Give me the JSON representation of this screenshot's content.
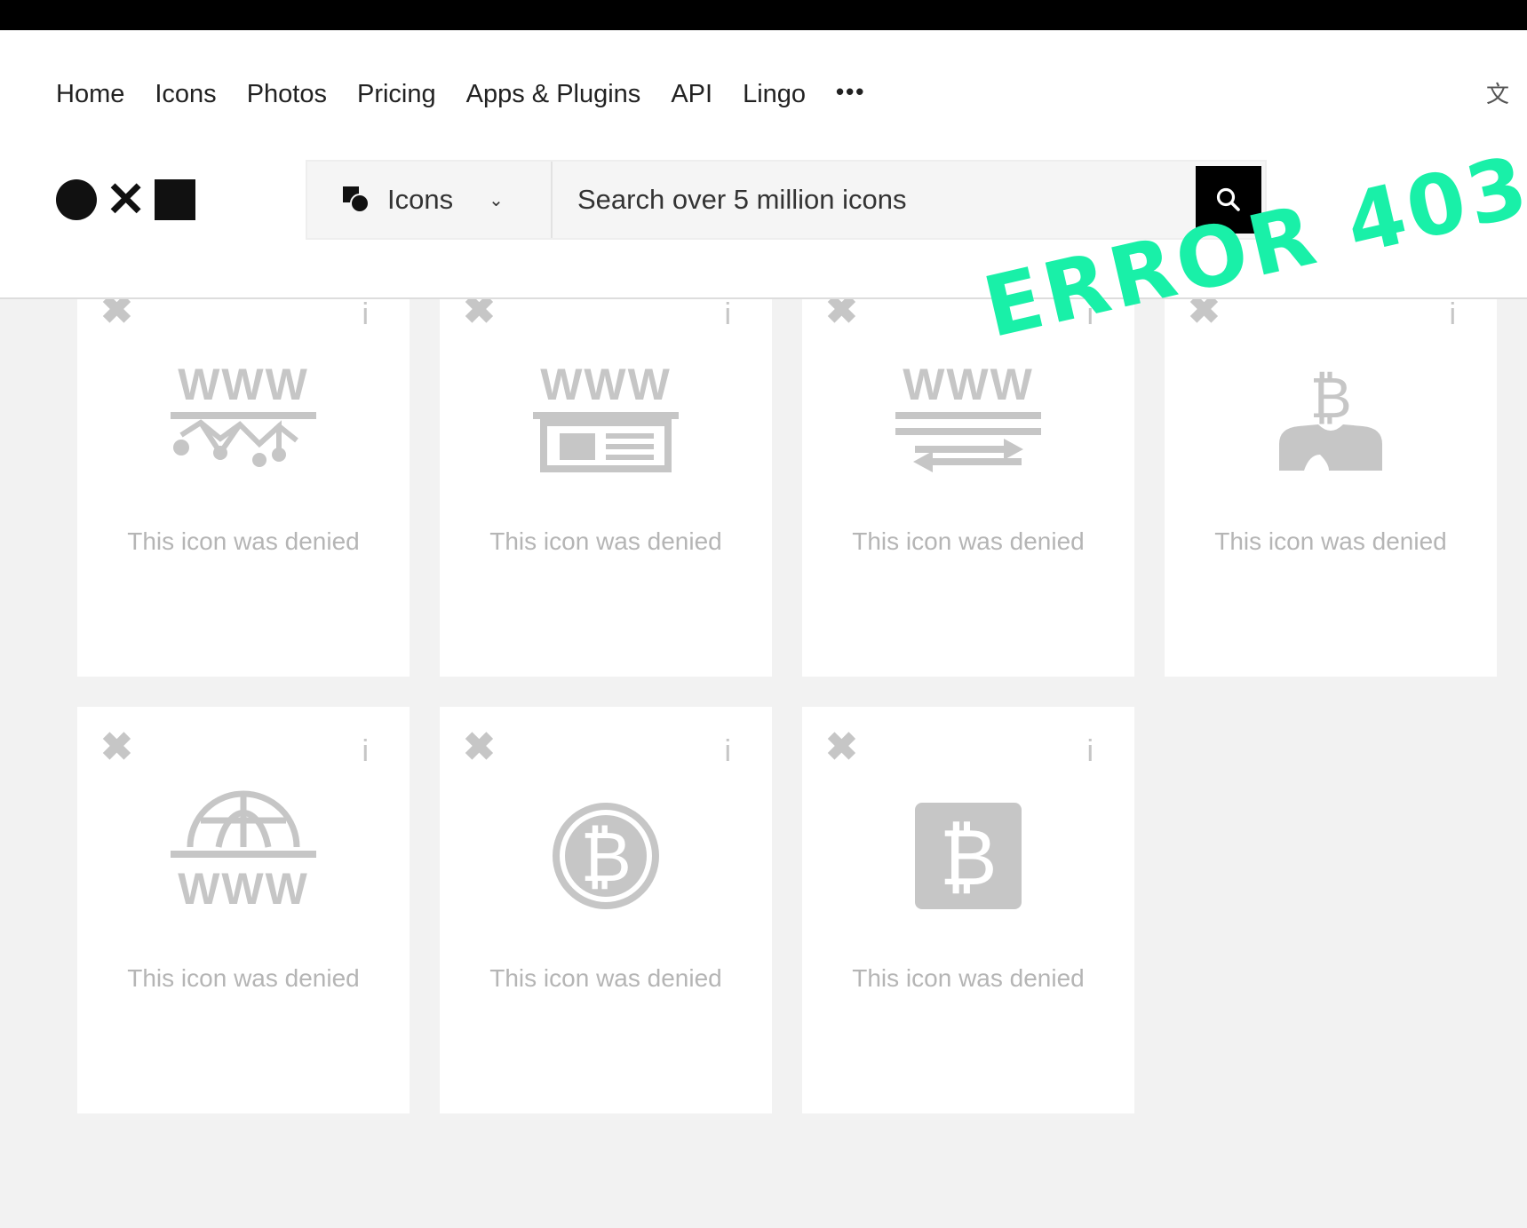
{
  "nav": {
    "items": [
      "Home",
      "Icons",
      "Photos",
      "Pricing",
      "Apps & Plugins",
      "API",
      "Lingo"
    ],
    "more": "•••",
    "corner_icon": "translate-icon"
  },
  "search": {
    "type_label": "Icons",
    "placeholder": "Search over 5 million icons",
    "search_icon": "search-icon"
  },
  "cards": [
    {
      "status": "This icon was denied",
      "icon": "www-network-icon"
    },
    {
      "status": "This icon was denied",
      "icon": "www-browser-icon"
    },
    {
      "status": "This icon was denied",
      "icon": "www-transfer-icon"
    },
    {
      "status": "This icon was denied",
      "icon": "bitcoin-person-icon"
    },
    {
      "status": "This icon was denied",
      "icon": "www-globe-icon"
    },
    {
      "status": "This icon was denied",
      "icon": "bitcoin-coin-icon"
    },
    {
      "status": "This icon was denied",
      "icon": "bitcoin-square-icon"
    }
  ],
  "card_actions": {
    "deny": "✖",
    "info": "i"
  },
  "overlay": {
    "text": "ERROR 403",
    "color": "#19f0a8"
  },
  "colors": {
    "denied_gray": "#c6c6c6",
    "background": "#f2f2f2"
  }
}
